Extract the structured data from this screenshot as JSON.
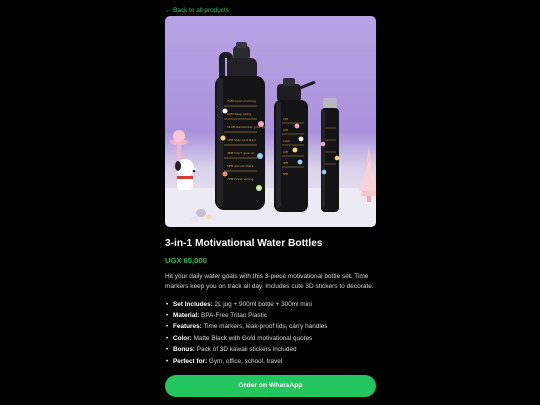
{
  "nav": {
    "back_label": "← Back to all products"
  },
  "product": {
    "image_alt": "3-in-1 Motivational Water Bottles",
    "title": "3-in-1 Motivational Water Bottles",
    "price": "UGX 65,000",
    "description": "Hit your daily water goals with this 3-piece motivational bottle set. Time markers keep you on track all day. Includes cute 3D stickers to decorate.",
    "specs": [
      {
        "key": "Set Includes:",
        "value": " 2L jug + 900ml bottle + 300ml mini"
      },
      {
        "key": "Material:",
        "value": " BPA-Free Tritan Plastic"
      },
      {
        "key": "Features:",
        "value": " Time markers, leak-proof lids, carry handles"
      },
      {
        "key": "Color:",
        "value": " Matte Black with Gold motivational quotes"
      },
      {
        "key": "Bonus:",
        "value": " Pack of 3D kawaii stickers included"
      },
      {
        "key": "Perfect for:",
        "value": " Gym, office, school, travel"
      }
    ],
    "order_label": "Order on WhatsApp"
  },
  "colors": {
    "background": "#000000",
    "accent": "#22c55e",
    "text": "#ffffff",
    "muted": "#d4d4d4"
  }
}
